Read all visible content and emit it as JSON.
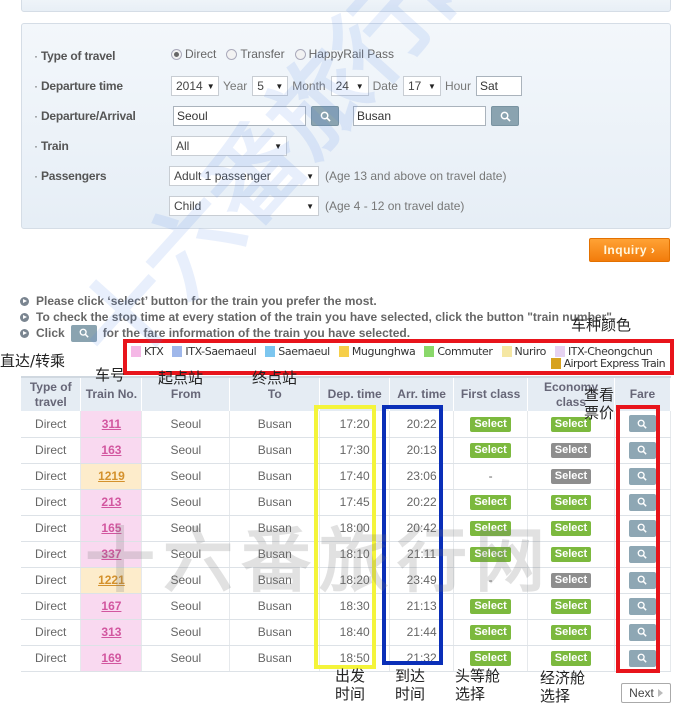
{
  "form": {
    "type_of_travel": {
      "label": "Type of travel",
      "options": [
        {
          "label": "Direct",
          "checked": true
        },
        {
          "label": "Transfer",
          "checked": false
        },
        {
          "label": "HappyRail Pass",
          "checked": false
        }
      ]
    },
    "departure_time": {
      "label": "Departure time",
      "year": "2014",
      "year_unit": "Year",
      "month": "5",
      "month_unit": "Month",
      "date": "24",
      "date_unit": "Date",
      "hour": "17",
      "hour_unit": "Hour",
      "weekday": "Sat"
    },
    "departure_arrival": {
      "label": "Departure/Arrival",
      "departure": "Seoul",
      "arrival": "Busan"
    },
    "train": {
      "label": "Train",
      "value": "All"
    },
    "passengers": {
      "label": "Passengers",
      "adult": "Adult 1 passenger",
      "adult_note": "(Age 13 and above on travel date)",
      "child": "Child",
      "child_note": "(Age 4 - 12 on travel date)"
    },
    "inquiry_label": "Inquiry ›"
  },
  "instructions": [
    "Please click ‘select’ button for the train you prefer the most.",
    "To check the stop time at every station of the train you have selected, click the button \"train number\".",
    "Click",
    "for the fare information of the train you have selected."
  ],
  "legend": {
    "items": [
      {
        "label": "KTX",
        "color": "#f5b8e6"
      },
      {
        "label": "ITX-Saemaeul",
        "color": "#9fb7ea"
      },
      {
        "label": "Saemaeul",
        "color": "#7cc6ef"
      },
      {
        "label": "Mugunghwa",
        "color": "#f6cf4a"
      },
      {
        "label": "Commuter",
        "color": "#8ad86a"
      },
      {
        "label": "Nuriro",
        "color": "#f5e7a3"
      },
      {
        "label": "ITX-Cheongchun",
        "color": "#e6d2f1"
      },
      {
        "label": "Airport Express Train",
        "color": "#d7a21e"
      }
    ]
  },
  "annotations": {
    "legend": "车种颜色",
    "type": "直达/转乘",
    "train_no": "车号",
    "from": "起点站",
    "to": "终点站",
    "fare": "查看\n票价",
    "dep": "出发\n时间",
    "arr": "到达\n时间",
    "first": "头等舱\n选择",
    "economy": "经济舱\n选择"
  },
  "table": {
    "headers": [
      "Type of travel",
      "Train No.",
      "From",
      "To",
      "Dep. time",
      "Arr. time",
      "First class",
      "Economy class",
      "Fare"
    ],
    "select_label": "Select",
    "rows": [
      {
        "type": "Direct",
        "train_no": "311",
        "kind": "KTX",
        "from": "Seoul",
        "to": "Busan",
        "dep": "17:20",
        "arr": "20:22",
        "first": "green",
        "economy": "green"
      },
      {
        "type": "Direct",
        "train_no": "163",
        "kind": "KTX",
        "from": "Seoul",
        "to": "Busan",
        "dep": "17:30",
        "arr": "20:13",
        "first": "green",
        "economy": "gray"
      },
      {
        "type": "Direct",
        "train_no": "1219",
        "kind": "Mugunghwa",
        "from": "Seoul",
        "to": "Busan",
        "dep": "17:40",
        "arr": "23:06",
        "first": "-",
        "economy": "gray"
      },
      {
        "type": "Direct",
        "train_no": "213",
        "kind": "KTX",
        "from": "Seoul",
        "to": "Busan",
        "dep": "17:45",
        "arr": "20:22",
        "first": "green",
        "economy": "green"
      },
      {
        "type": "Direct",
        "train_no": "165",
        "kind": "KTX",
        "from": "Seoul",
        "to": "Busan",
        "dep": "18:00",
        "arr": "20:42",
        "first": "green",
        "economy": "green"
      },
      {
        "type": "Direct",
        "train_no": "337",
        "kind": "KTX",
        "from": "Seoul",
        "to": "Busan",
        "dep": "18:10",
        "arr": "21:11",
        "first": "green",
        "economy": "green"
      },
      {
        "type": "Direct",
        "train_no": "1221",
        "kind": "Mugunghwa",
        "from": "Seoul",
        "to": "Busan",
        "dep": "18:20",
        "arr": "23:49",
        "first": "-",
        "economy": "gray"
      },
      {
        "type": "Direct",
        "train_no": "167",
        "kind": "KTX",
        "from": "Seoul",
        "to": "Busan",
        "dep": "18:30",
        "arr": "21:13",
        "first": "green",
        "economy": "green"
      },
      {
        "type": "Direct",
        "train_no": "313",
        "kind": "KTX",
        "from": "Seoul",
        "to": "Busan",
        "dep": "18:40",
        "arr": "21:44",
        "first": "green",
        "economy": "green"
      },
      {
        "type": "Direct",
        "train_no": "169",
        "kind": "KTX",
        "from": "Seoul",
        "to": "Busan",
        "dep": "18:50",
        "arr": "21:32",
        "first": "green",
        "economy": "green"
      }
    ]
  },
  "pagination": {
    "next_label": "Next"
  },
  "watermark": {
    "text": "十六番旅行网"
  }
}
